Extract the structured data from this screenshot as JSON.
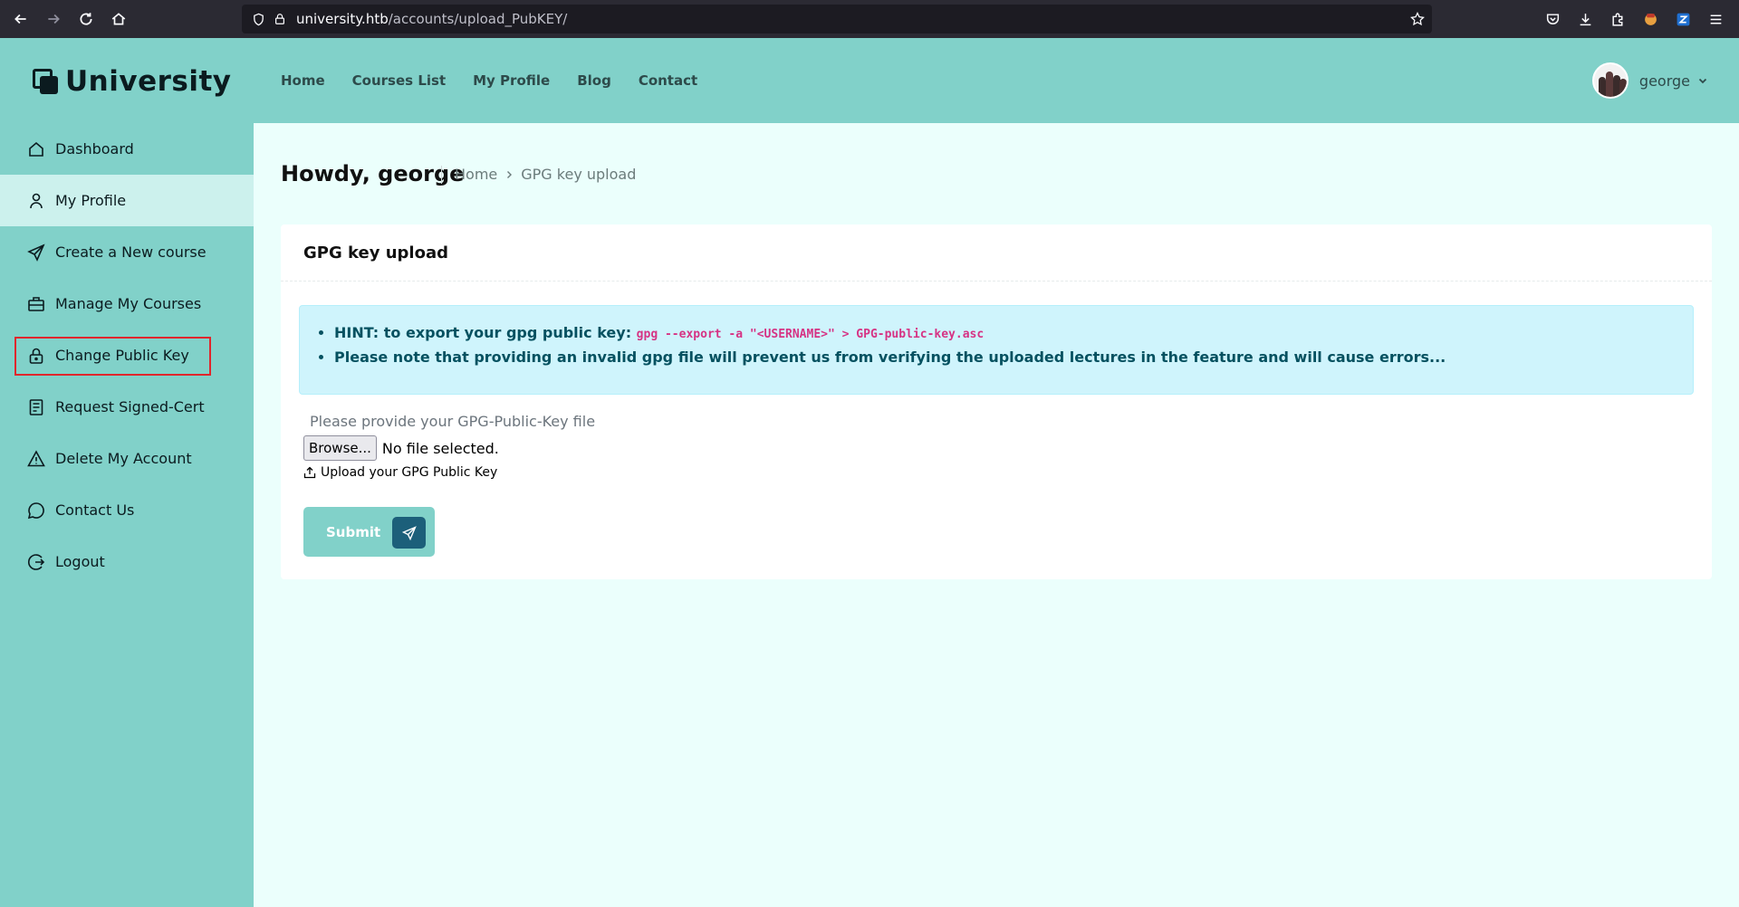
{
  "browser": {
    "url_host": "university.htb",
    "url_path": "/accounts/upload_PubKEY/"
  },
  "header": {
    "logo": "University",
    "nav": [
      "Home",
      "Courses List",
      "My Profile",
      "Blog",
      "Contact"
    ],
    "user_name": "george"
  },
  "sidebar": {
    "items": [
      {
        "label": "Dashboard",
        "icon": "home-icon"
      },
      {
        "label": "My Profile",
        "icon": "user-icon"
      },
      {
        "label": "Create a New course",
        "icon": "send-icon"
      },
      {
        "label": "Manage My Courses",
        "icon": "briefcase-icon"
      },
      {
        "label": "Change Public Key",
        "icon": "lock-icon"
      },
      {
        "label": "Request Signed-Cert",
        "icon": "document-icon"
      },
      {
        "label": "Delete My Account",
        "icon": "warning-icon"
      },
      {
        "label": "Contact Us",
        "icon": "chat-icon"
      },
      {
        "label": "Logout",
        "icon": "logout-icon"
      }
    ],
    "active_index": 1,
    "highlighted_index": 4
  },
  "main": {
    "greeting": "Howdy, george",
    "breadcrumb": [
      "Home",
      "GPG key upload"
    ],
    "card_title": "GPG key upload",
    "hint_prefix": "HINT: to export your gpg public key: ",
    "hint_code": "gpg --export -a \"<USERNAME>\" > GPG-public-key.asc",
    "note": "Please note that providing an invalid gpg file will prevent us from verifying the uploaded lectures in the feature and will cause errors...",
    "file_label": "Please provide your GPG-Public-Key file",
    "browse_label": "Browse...",
    "no_file": "No file selected.",
    "upload_hint": "Upload your GPG Public Key",
    "submit_label": "Submit"
  },
  "colors": {
    "accent": "#81d1c9",
    "page_bg": "#ebfffc",
    "highlight": "#e0262c",
    "submit_icon_bg": "#1c5f7a"
  }
}
